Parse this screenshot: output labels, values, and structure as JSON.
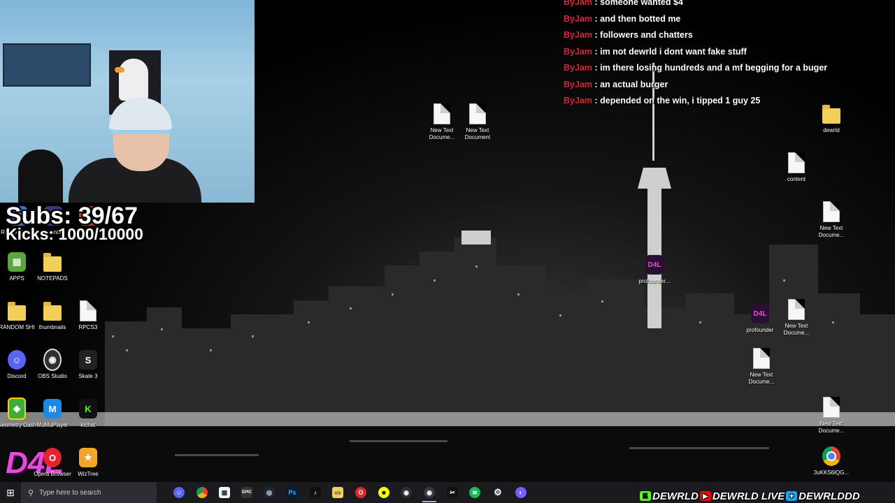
{
  "stream": {
    "subs_label": "Subs: 39/67",
    "kicks_label": "Kicks: 1000/10000"
  },
  "chat": [
    {
      "user": "ByJam",
      "message": "someone wanted $4"
    },
    {
      "user": "ByJam",
      "message": "and then botted me"
    },
    {
      "user": "ByJam",
      "message": "followers and chatters"
    },
    {
      "user": "ByJam",
      "message": "im not dewrld i dont want fake stuff"
    },
    {
      "user": "ByJam",
      "message": "im there losing hundreds and a mf begging for a buger"
    },
    {
      "user": "ByJam",
      "message": "an actual burger"
    },
    {
      "user": "ByJam",
      "message": "depended on the win, i tipped 1 guy 25"
    }
  ],
  "desktop": {
    "left_icons": [
      {
        "label": "Roblox Player",
        "icon": "roblox-icon",
        "color": "#3c6fd8"
      },
      {
        "label": "Fortnite",
        "icon": "fortnite-icon",
        "color": "#3a3a7a"
      },
      {
        "label": "Roblox",
        "icon": "roblox-icon",
        "color": "#c0392b"
      },
      {
        "label": "APPS",
        "icon": "folder-icon",
        "color": "#f2cf5b"
      },
      {
        "label": "NOTEPADS",
        "icon": "folder-icon",
        "color": "#f2cf5b"
      },
      {
        "label": "RANDOM SHI",
        "icon": "folder-icon",
        "color": "#f2cf5b"
      },
      {
        "label": "thumbnails",
        "icon": "folder-icon",
        "color": "#f2cf5b"
      },
      {
        "label": "RPCS3",
        "icon": "document-icon",
        "color": "#ffffff"
      },
      {
        "label": "Discord",
        "icon": "discord-icon",
        "color": "#5865f2"
      },
      {
        "label": "OBS Studio",
        "icon": "obs-icon",
        "color": "#302e31"
      },
      {
        "label": "Skate 3",
        "icon": "skate-icon",
        "color": "#222222"
      },
      {
        "label": "Geometry Dash",
        "icon": "geometry-dash-icon",
        "color": "#3fae36"
      },
      {
        "label": "MuMuPlayer",
        "icon": "mumu-icon",
        "color": "#1e88e5"
      },
      {
        "label": "kichat",
        "icon": "kick-icon",
        "color": "#111111"
      },
      {
        "label": "TikTok",
        "icon": "d4l-icon",
        "color": "#e84ad9"
      },
      {
        "label": "Opera Browser",
        "icon": "opera-icon",
        "color": "#e0252c"
      },
      {
        "label": "WizTree",
        "icon": "wiztree-icon",
        "color": "#f1a52a"
      }
    ],
    "right_icons": [
      {
        "label": "New Text Docume...",
        "icon": "document-icon"
      },
      {
        "label": "New Text Document",
        "icon": "document-icon"
      },
      {
        "label": "dewrld",
        "icon": "folder-icon"
      },
      {
        "label": "content",
        "icon": "document-icon"
      },
      {
        "label": "New Text Docume...",
        "icon": "document-icon"
      },
      {
        "label": "profounder...",
        "icon": "d4l-icon"
      },
      {
        "label": "profounder",
        "icon": "d4l-icon"
      },
      {
        "label": "New Text Docume...",
        "icon": "document-icon"
      },
      {
        "label": "New Text Docume...",
        "icon": "document-icon"
      },
      {
        "label": "New Text Docume...",
        "icon": "document-icon"
      },
      {
        "label": "3uKKS6lQG...",
        "icon": "chrome-icon"
      }
    ]
  },
  "taskbar": {
    "search_placeholder": "Type here to search",
    "apps": [
      "discord-icon",
      "chrome-icon",
      "store-icon",
      "epic-icon",
      "steam-icon",
      "photoshop-icon",
      "tiktok-icon",
      "explorer-icon",
      "opera-icon",
      "snapchat-icon",
      "obs-icon",
      "obs-active-icon",
      "capcut-icon",
      "spotify-icon",
      "settings-icon",
      "browser-icon"
    ],
    "epic_label": "EPIC",
    "ps_label": "Ps"
  },
  "socials": [
    {
      "platform": "kick",
      "handle": "DEWRLD",
      "color": "#53fc18"
    },
    {
      "platform": "youtube",
      "handle": "DEWRLD LIVE",
      "color": "#ff0000"
    },
    {
      "platform": "twitter",
      "handle": "DEWRLDDD",
      "color": "#1da1f2"
    }
  ],
  "logo_text": "D4L"
}
